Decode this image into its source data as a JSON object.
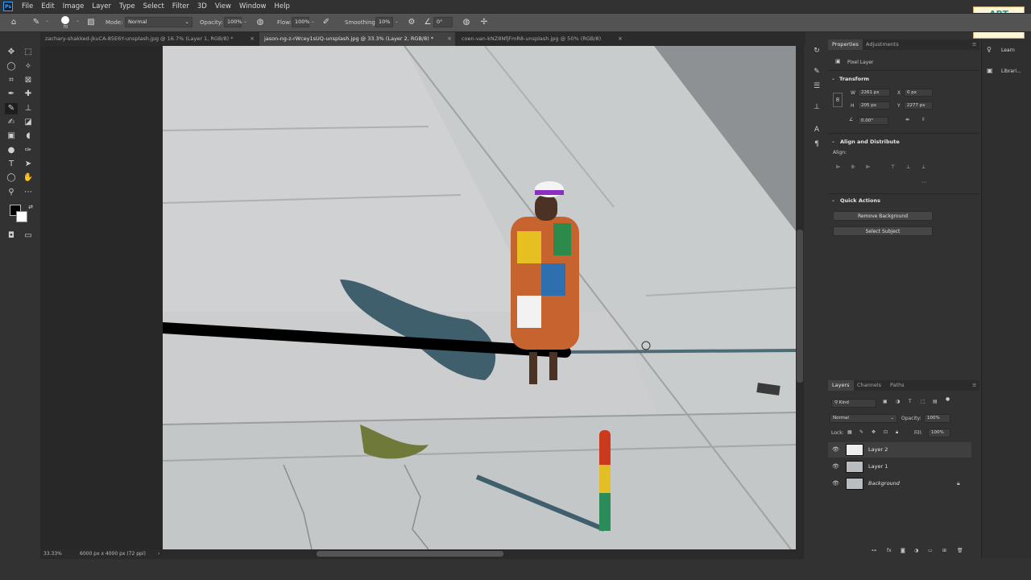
{
  "menubar": {
    "logo": "Ps",
    "items": [
      "File",
      "Edit",
      "Image",
      "Layer",
      "Type",
      "Select",
      "Filter",
      "3D",
      "View",
      "Window",
      "Help"
    ]
  },
  "options": {
    "brush_size": "70",
    "mode_label": "Mode:",
    "mode_value": "Normal",
    "opacity_label": "Opacity:",
    "opacity_value": "100%",
    "flow_label": "Flow:",
    "flow_value": "100%",
    "smoothing_label": "Smoothing:",
    "smoothing_value": "10%",
    "angle_value": "0°"
  },
  "tabs": [
    {
      "label": "zachary-shakked-jkuCA-85E6Y-unsplash.jpg @ 16.7% (Layer 1, RGB/8) *",
      "active": false
    },
    {
      "label": "jason-ng-z-rWcey1sUQ-unsplash.jpg @ 33.3% (Layer 2, RGB/8) *",
      "active": true
    },
    {
      "label": "coen-van-kNZ8NfjFmR8-unsplash.jpg @ 50% (RGB/8)",
      "active": false
    }
  ],
  "status": {
    "zoom": "33.33%",
    "doc_info": "6000 px x 4000 px (72 ppi)"
  },
  "properties": {
    "tabs": [
      "Properties",
      "Adjustments"
    ],
    "layer_type": "Pixel Layer",
    "transform_title": "Transform",
    "w_label": "W",
    "w_value": "2261 px",
    "h_label": "H",
    "h_value": "205 px",
    "x_label": "X",
    "x_value": "0 px",
    "y_label": "Y",
    "y_value": "2277 px",
    "angle_value": "0.00°",
    "align_title": "Align and Distribute",
    "align_label": "Align:",
    "quick_title": "Quick Actions",
    "remove_bg": "Remove Background",
    "select_subject": "Select Subject"
  },
  "layers_panel": {
    "tabs": [
      "Layers",
      "Channels",
      "Paths"
    ],
    "kind_label": "Kind",
    "blend_mode": "Normal",
    "opacity_label": "Opacity:",
    "opacity_value": "100%",
    "lock_label": "Lock:",
    "fill_label": "Fill:",
    "fill_value": "100%",
    "layers": [
      {
        "name": "Layer 2",
        "selected": true
      },
      {
        "name": "Layer 1",
        "selected": false
      },
      {
        "name": "Background",
        "selected": false,
        "locked": true
      }
    ]
  },
  "right_strip": {
    "items": [
      "Learn",
      "Librari..."
    ]
  },
  "channel_logo": {
    "line1": "ART",
    "line2": "animation",
    "line3": "Tutor"
  }
}
